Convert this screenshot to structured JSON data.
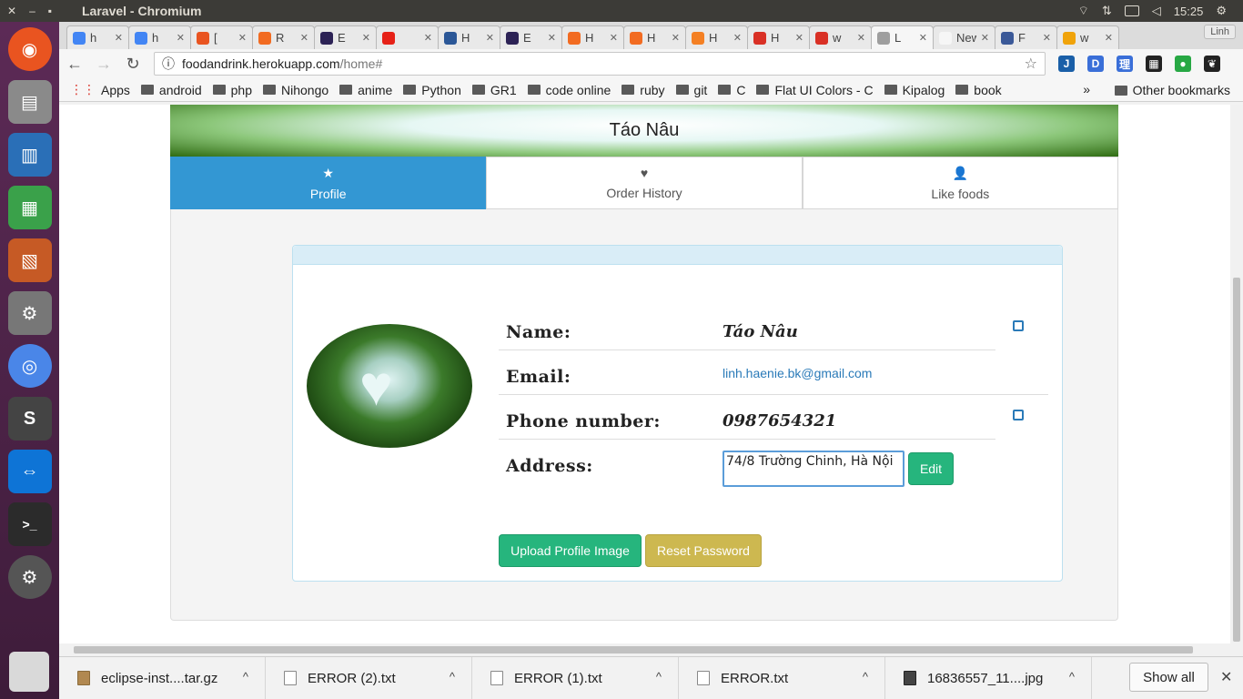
{
  "system": {
    "window_title": "Laravel - Chromium",
    "clock": "15:25",
    "close_glyph": "✕",
    "min_glyph": "–",
    "max_glyph": "▪"
  },
  "chrome": {
    "tabs": [
      {
        "label": "h",
        "color": "#4285f4"
      },
      {
        "label": "h",
        "color": "#4285f4"
      },
      {
        "label": "[",
        "color": "#e95420"
      },
      {
        "label": "R",
        "color": "#f26b21"
      },
      {
        "label": "E",
        "color": "#2c2255"
      },
      {
        "label": "",
        "color": "#e62117"
      },
      {
        "label": "H",
        "color": "#2b5797"
      },
      {
        "label": "E",
        "color": "#2c2255"
      },
      {
        "label": "H",
        "color": "#f26b21"
      },
      {
        "label": "H",
        "color": "#f26b21"
      },
      {
        "label": "H",
        "color": "#f48024"
      },
      {
        "label": "H",
        "color": "#d93025"
      },
      {
        "label": "w",
        "color": "#d93025"
      },
      {
        "label": "L",
        "color": "#9e9e9e",
        "active": true
      },
      {
        "label": "New",
        "color": "#f6f6f6"
      },
      {
        "label": "F",
        "color": "#3b5998"
      },
      {
        "label": "w",
        "color": "#f0a30a"
      }
    ],
    "user_badge": "Linh",
    "url_host": "foodandrink.herokuapp.com",
    "url_path": "/home#",
    "bookmarks": [
      "Apps",
      "android",
      "php",
      "Nihongo",
      "anime",
      "Python",
      "GR1",
      "code online",
      "ruby",
      "git",
      "C",
      "Flat UI Colors - C",
      "Kipalog",
      "book"
    ],
    "bookmarks_more": "»",
    "other_bookmarks": "Other bookmarks",
    "extensions": [
      {
        "label": "J",
        "color": "#1a5fa8"
      },
      {
        "label": "D",
        "color": "#3a6fd8"
      },
      {
        "label": "理",
        "color": "#3a6fd8"
      },
      {
        "label": "▦",
        "color": "#222222"
      },
      {
        "label": "●",
        "color": "#27a844"
      },
      {
        "label": "❦",
        "color": "#222222"
      }
    ]
  },
  "page": {
    "banner_title": "Táo Nâu",
    "tabs": [
      {
        "label": "Profile",
        "glyph": "★",
        "active": true
      },
      {
        "label": "Order History",
        "glyph": "♥",
        "active": false
      },
      {
        "label": "Like foods",
        "glyph": "👤",
        "active": false
      }
    ],
    "profile": {
      "name_label": "Name:",
      "name_value": "Táo Nâu",
      "email_label": "Email:",
      "email_value": "linh.haenie.bk@gmail.com",
      "phone_label": "Phone number:",
      "phone_value": "0987654321",
      "address_label": "Address:",
      "address_value": "74/8 Trường Chinh, Hà Nội",
      "edit_button": "Edit",
      "upload_button": "Upload Profile Image",
      "reset_button": "Reset Password"
    }
  },
  "downloads": {
    "items": [
      {
        "name": "eclipse-inst....tar.gz",
        "type": "package"
      },
      {
        "name": "ERROR (2).txt",
        "type": "text"
      },
      {
        "name": "ERROR (1).txt",
        "type": "text"
      },
      {
        "name": "ERROR.txt",
        "type": "text"
      },
      {
        "name": "16836557_11....jpg",
        "type": "image"
      }
    ],
    "show_all": "Show all",
    "close_glyph": "✕",
    "caret_glyph": "^"
  }
}
